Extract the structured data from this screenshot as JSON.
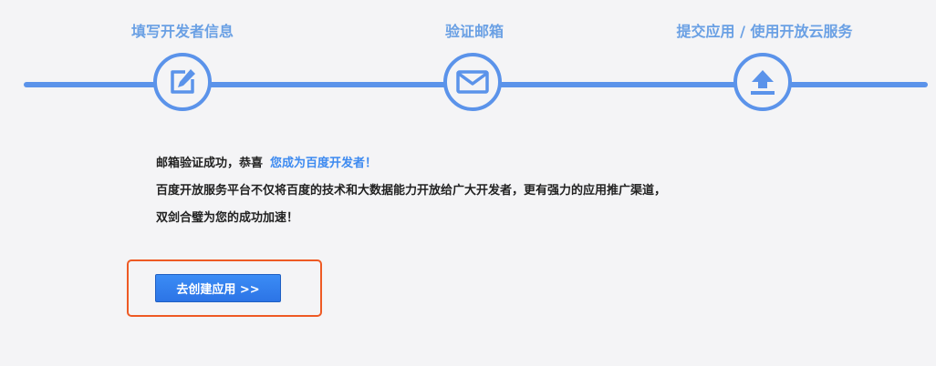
{
  "steps": [
    {
      "label": "填写开发者信息",
      "icon": "edit-icon"
    },
    {
      "label": "验证邮箱",
      "icon": "envelope-icon"
    },
    {
      "label": "提交应用 / 使用开放云服务",
      "icon": "upload-icon"
    }
  ],
  "message": {
    "line1_text": "邮箱验证成功，恭喜",
    "line1_highlight": "您成为百度开发者！",
    "line2": "百度开放服务平台不仅将百度的技术和大数据能力开放给广大开发者，更有强力的应用推广渠道，",
    "line3": "双剑合璧为您的成功加速！"
  },
  "action": {
    "create_app_label": "去创建应用 >>"
  },
  "colors": {
    "accent": "#5b93ea",
    "step_label": "#6aa0e4",
    "highlight_text": "#3d8af0",
    "button": "#2f7fef",
    "annotation_box": "#ee5a24"
  }
}
